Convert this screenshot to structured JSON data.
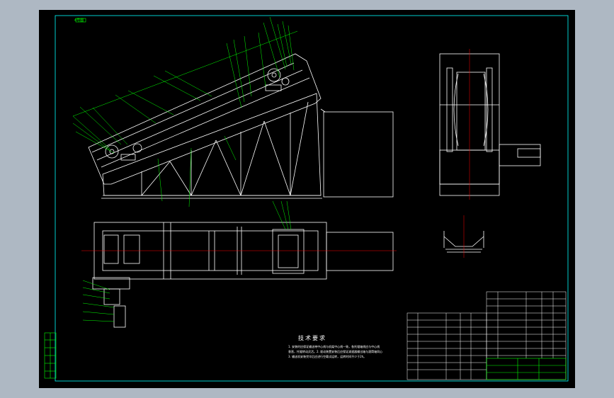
{
  "canvas": {
    "background": "#aeb8c3",
    "sheet": "#000000"
  },
  "colors": {
    "line": "#ffffff",
    "leader": "#00ff00",
    "frame": "#00ffff",
    "center": "#ff0000",
    "yellow": "#ffff00"
  },
  "corner_tag": "4号图",
  "tech_requirements": {
    "title": "技术要求",
    "lines": [
      "1. 安装时应保证输送带中心线与机架中心线一致，各托辊轴线应与中心线",
      "垂直，托辊转动灵活。2. 驱动装置安装后应保证减速器输出轴与滚筒轴同心",
      "3. 输送机安装完毕后应进行空载试运转，运转时间不少于2h。"
    ]
  },
  "views": [
    "side-elevation",
    "end-view",
    "plan-view",
    "idler-section"
  ],
  "parts_list": {
    "label": "明细表"
  },
  "title_block": {
    "label": "标题栏"
  }
}
